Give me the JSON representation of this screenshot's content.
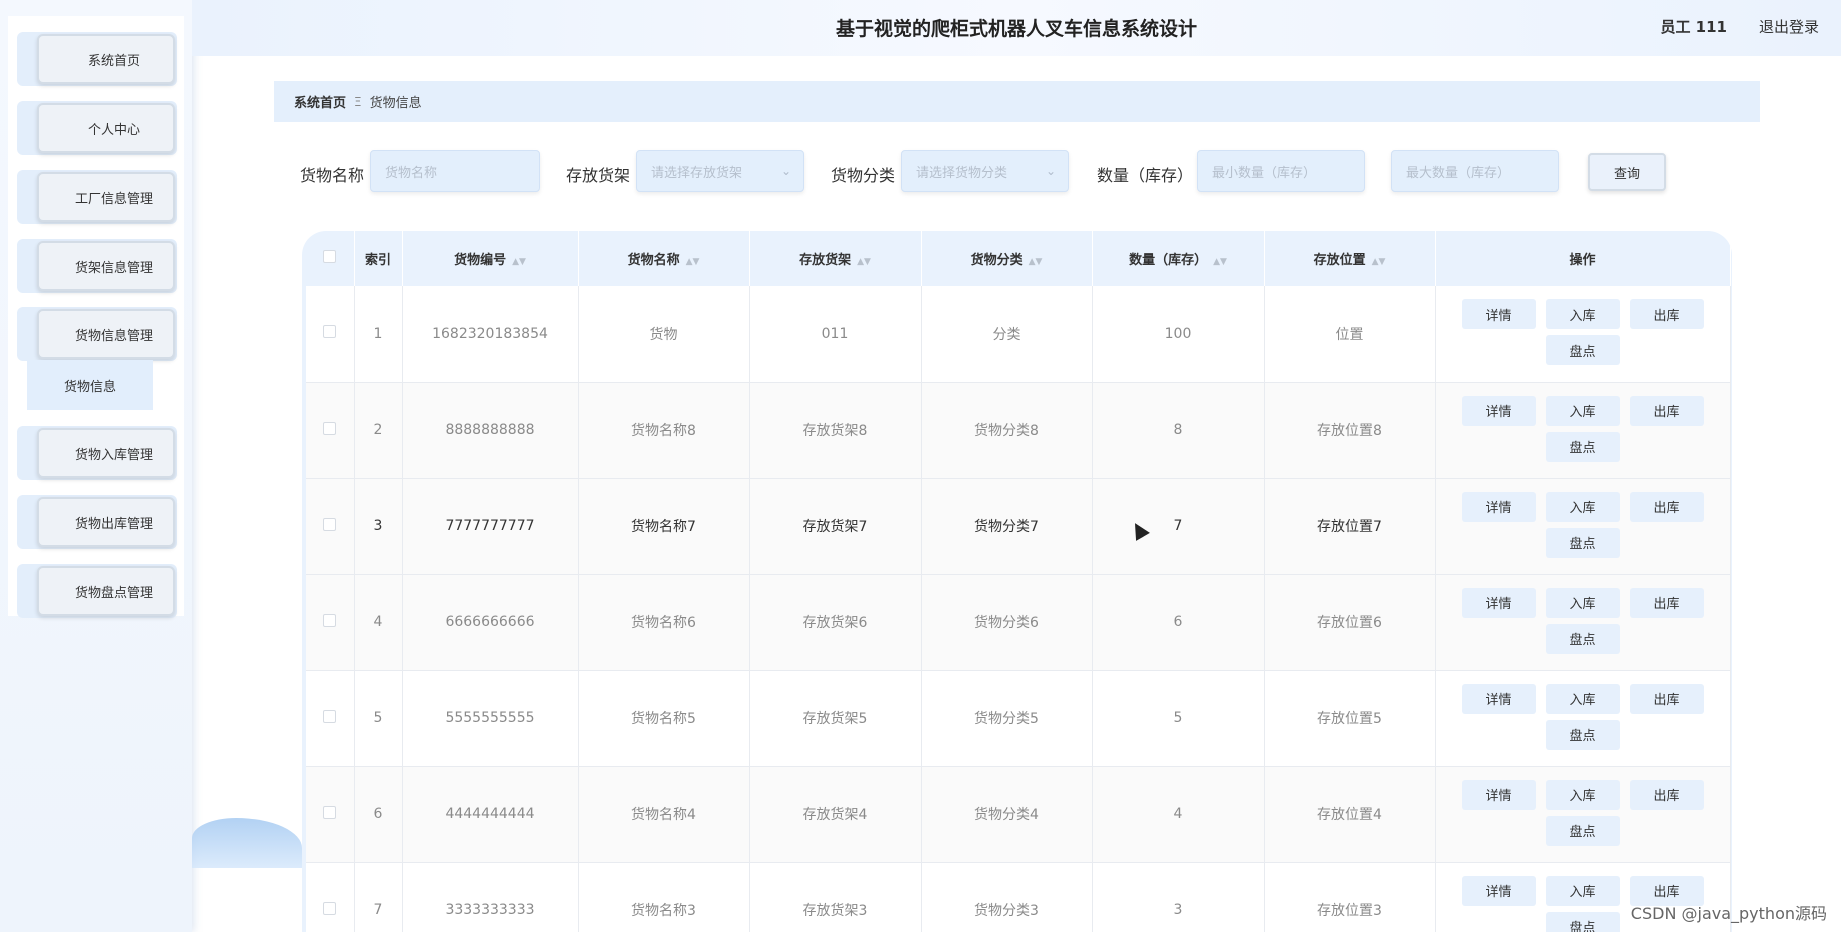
{
  "header": {
    "title": "基于视觉的爬柜式机器人叉车信息系统设计",
    "user": "员工 111",
    "logout": "退出登录"
  },
  "sidebar": {
    "items": [
      {
        "label": "系统首页"
      },
      {
        "label": "个人中心"
      },
      {
        "label": "工厂信息管理"
      },
      {
        "label": "货架信息管理"
      },
      {
        "label": "货物信息管理"
      },
      {
        "label": "货物入库管理"
      },
      {
        "label": "货物出库管理"
      },
      {
        "label": "货物盘点管理"
      }
    ],
    "submenu": {
      "label": "货物信息"
    }
  },
  "breadcrumb": {
    "home": "系统首页",
    "separator": "Ξ",
    "current": "货物信息"
  },
  "search": {
    "name_label": "货物名称",
    "name_placeholder": "货物名称",
    "shelf_label": "存放货架",
    "shelf_placeholder": "请选择存放货架",
    "category_label": "货物分类",
    "category_placeholder": "请选择货物分类",
    "qty_label": "数量（库存）",
    "min_placeholder": "最小数量（库存）",
    "max_placeholder": "最大数量（库存）",
    "query_button": "查询"
  },
  "table": {
    "headers": [
      "索引",
      "货物编号",
      "货物名称",
      "存放货架",
      "货物分类",
      "数量（库存）",
      "存放位置",
      "操作"
    ],
    "rows": [
      {
        "index": "1",
        "code": "1682320183854",
        "name": "货物",
        "shelf": "011",
        "category": "分类",
        "qty": "100",
        "location": "位置"
      },
      {
        "index": "2",
        "code": "8888888888",
        "name": "货物名称8",
        "shelf": "存放货架8",
        "category": "货物分类8",
        "qty": "8",
        "location": "存放位置8"
      },
      {
        "index": "3",
        "code": "7777777777",
        "name": "货物名称7",
        "shelf": "存放货架7",
        "category": "货物分类7",
        "qty": "7",
        "location": "存放位置7"
      },
      {
        "index": "4",
        "code": "6666666666",
        "name": "货物名称6",
        "shelf": "存放货架6",
        "category": "货物分类6",
        "qty": "6",
        "location": "存放位置6"
      },
      {
        "index": "5",
        "code": "5555555555",
        "name": "货物名称5",
        "shelf": "存放货架5",
        "category": "货物分类5",
        "qty": "5",
        "location": "存放位置5"
      },
      {
        "index": "6",
        "code": "4444444444",
        "name": "货物名称4",
        "shelf": "存放货架4",
        "category": "货物分类4",
        "qty": "4",
        "location": "存放位置4"
      },
      {
        "index": "7",
        "code": "3333333333",
        "name": "货物名称3",
        "shelf": "存放货架3",
        "category": "货物分类3",
        "qty": "3",
        "location": "存放位置3"
      }
    ],
    "actions": {
      "detail": "详情",
      "in": "入库",
      "out": "出库",
      "check": "盘点"
    }
  },
  "watermark": "CSDN @java_python源码",
  "colors": {
    "accent": "#e3effc",
    "sidebar": "#eef4fc"
  }
}
